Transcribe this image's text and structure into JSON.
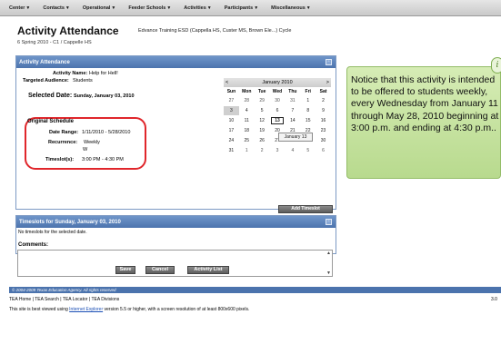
{
  "nav": {
    "items": [
      {
        "label": "Center"
      },
      {
        "label": "Contacts"
      },
      {
        "label": "Operational"
      },
      {
        "label": "Feeder Schools"
      },
      {
        "label": "Activities"
      },
      {
        "label": "Participants"
      },
      {
        "label": "Miscellaneous"
      }
    ]
  },
  "header": {
    "title": "Activity Attendance",
    "subtitle": "Edvance Training ESD (Cappella HS, Custer MS, Brown Ele...) Cycle",
    "session": "6 Spring 2010 - C1 / Cappelle HS"
  },
  "panel": {
    "title": "Activity Attendance",
    "activity_name_label": "Activity Name:",
    "activity_name_value": "Help for Hell!",
    "audience_label": "Targeted Audience:",
    "audience_value": "Students",
    "selected_date_label": "Selected Date:",
    "selected_date_value": "Sunday, January 03, 2010",
    "original_schedule_title": "Original Schedule",
    "date_range_label": "Date Range:",
    "date_range_value": "1/11/2010 - 5/28/2010",
    "recurrence_label": "Recurrence:",
    "recurrence_value": "Weekly",
    "recurrence_day": "W",
    "timeslots_label": "Timeslot(s):",
    "timeslots_value": "3:00 PM - 4:30 PM"
  },
  "calendar": {
    "prev": "<",
    "next": ">",
    "month": "January 2010",
    "days_of_week": [
      "Sun",
      "Mon",
      "Tue",
      "Wed",
      "Thu",
      "Fri",
      "Sat"
    ],
    "weeks": [
      [
        "27",
        "28",
        "29",
        "30",
        "31",
        "1",
        "2"
      ],
      [
        "3",
        "4",
        "5",
        "6",
        "7",
        "8",
        "9"
      ],
      [
        "10",
        "11",
        "12",
        "13",
        "14",
        "15",
        "16"
      ],
      [
        "17",
        "18",
        "19",
        "20",
        "21",
        "22",
        "23"
      ],
      [
        "24",
        "25",
        "26",
        "27",
        "28",
        "29",
        "30"
      ],
      [
        "31",
        "1",
        "2",
        "3",
        "4",
        "5",
        "6"
      ]
    ],
    "tooltip": "January 13"
  },
  "add_timeslot_label": "Add Timeslot",
  "timeslots_panel": {
    "title": "Timeslots for Sunday, January 03, 2010",
    "empty_message": "No timeslots for the selected date.",
    "comments_label": "Comments:",
    "comments_value": ""
  },
  "buttons": {
    "save": "Save",
    "cancel": "Cancel",
    "activity_list": "Activity List"
  },
  "footer": {
    "copyright": "© 2004-2009 Texas Education Agency. All rights reserved",
    "links": [
      "TEA Home",
      "TEA Search",
      "TEA Locator",
      "TEA Divisions"
    ],
    "version": "3.0",
    "note_prefix": "This site is best viewed using",
    "note_link": "Internet Explorer",
    "note_suffix": "version 5.5 or higher, with a screen resolution of at least 800x600 pixels."
  },
  "callout": {
    "text": "Notice that this activity is intended to be offered to students weekly, every Wednesday from January 11 through May 28, 2010 beginning at 3:00 p.m. and ending at 4:30 p.m..",
    "tab_glyph": "i"
  }
}
